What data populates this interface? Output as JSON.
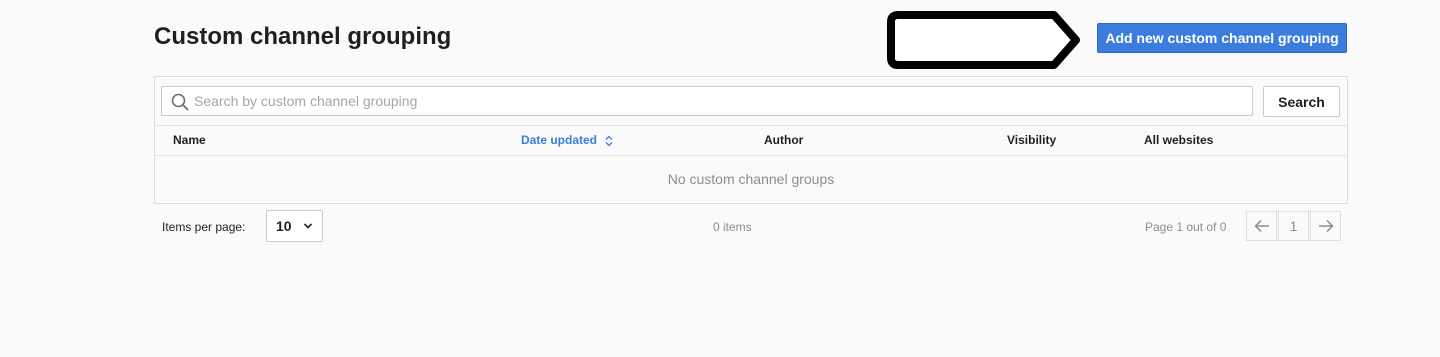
{
  "header": {
    "title": "Custom channel grouping",
    "add_button_label": "Add new custom channel grouping"
  },
  "search": {
    "placeholder": "Search by custom channel grouping",
    "value": "",
    "button_label": "Search"
  },
  "table": {
    "columns": {
      "name": "Name",
      "date_updated": "Date updated",
      "author": "Author",
      "visibility": "Visibility",
      "all_websites": "All websites"
    },
    "sorted_column": "date_updated",
    "empty_message": "No custom channel groups"
  },
  "footer": {
    "items_per_page_label": "Items per page:",
    "items_per_page_value": "10",
    "items_count": "0 items",
    "page_info": "Page 1 out of 0",
    "current_page": "1"
  },
  "icons": {
    "search": "search-icon",
    "sort": "sort-icon",
    "chevron": "chevron-down-icon",
    "prev": "arrow-left-icon",
    "next": "arrow-right-icon"
  },
  "colors": {
    "accent": "#3b7ddd",
    "background": "#fafafa",
    "border": "#dcdcdc",
    "muted_text": "#8c8c8c"
  }
}
